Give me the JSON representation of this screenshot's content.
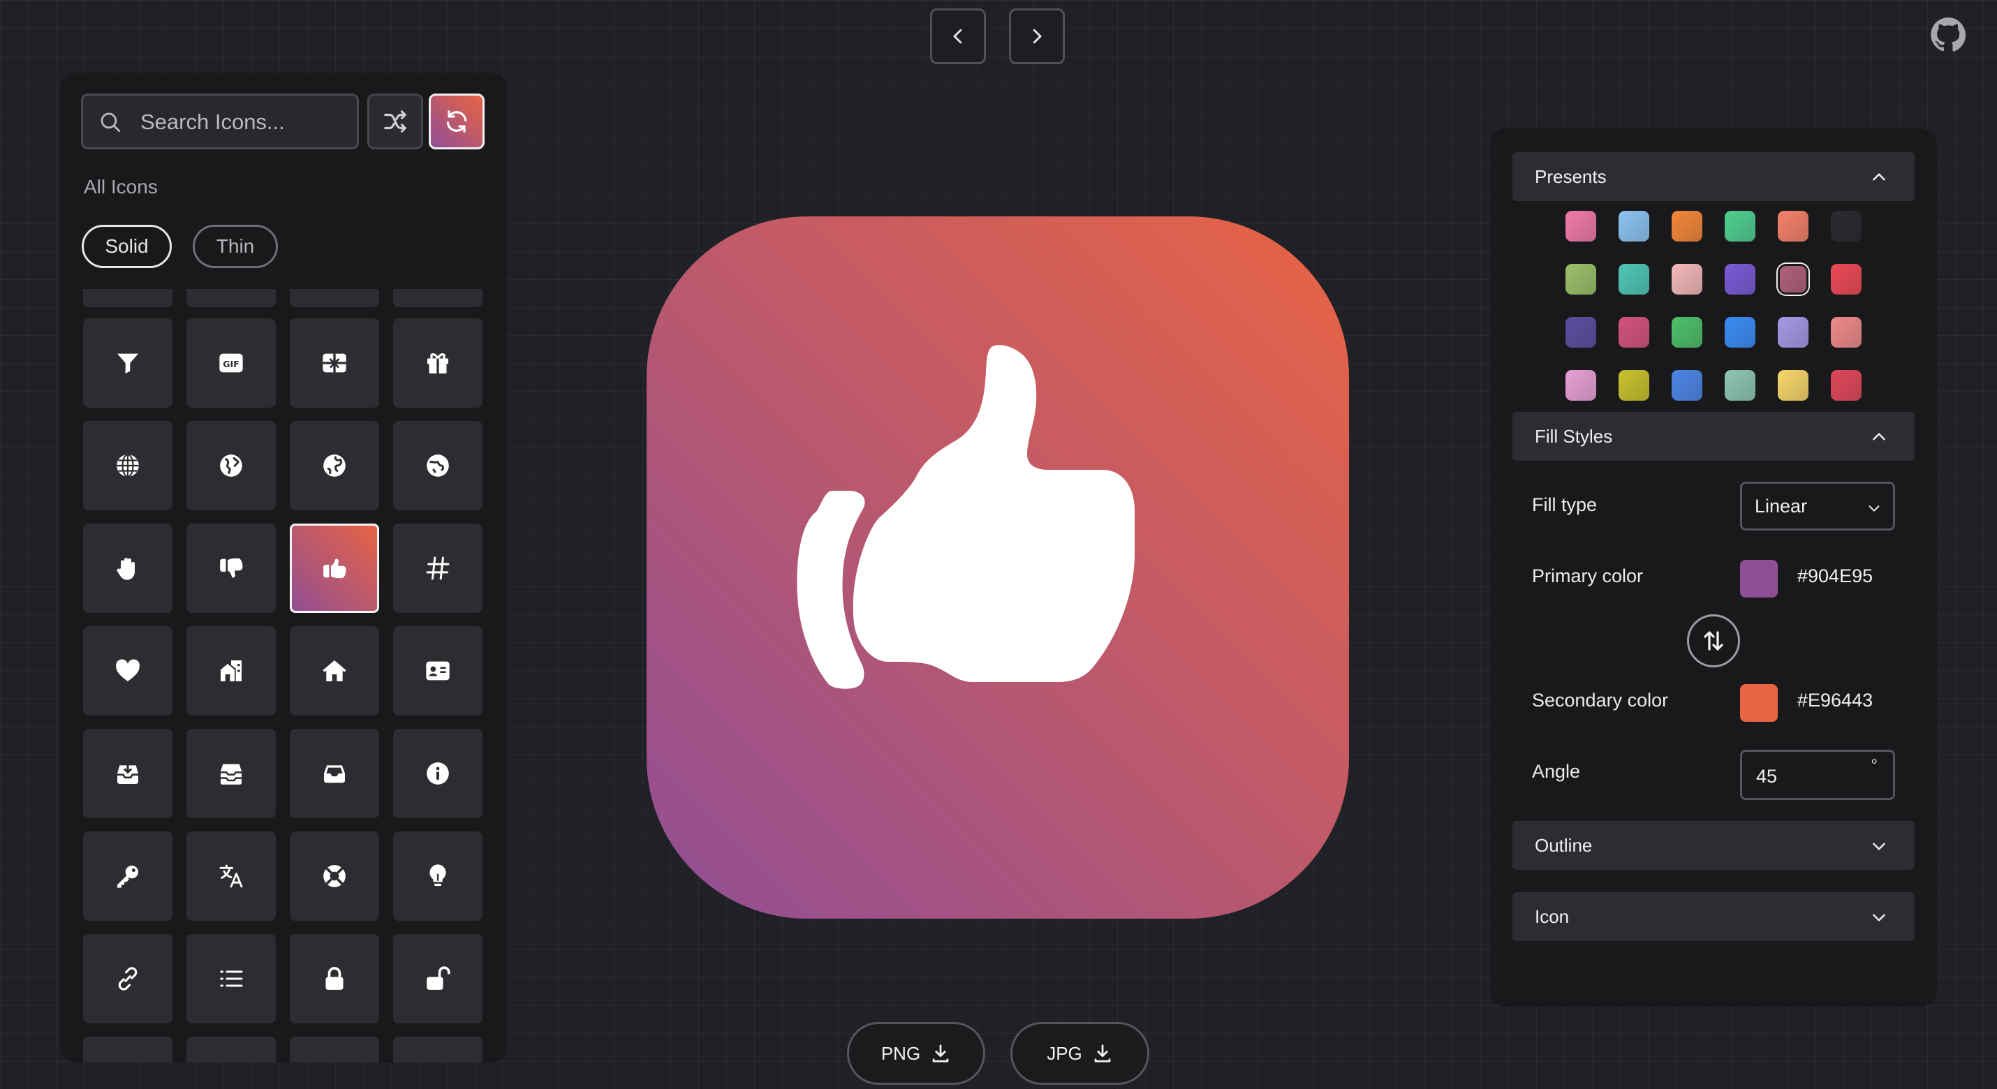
{
  "nav": {
    "prev_icon": "chevron-left-icon",
    "next_icon": "chevron-right-icon",
    "github_icon": "github-icon"
  },
  "sidebar": {
    "search_placeholder": "Search Icons...",
    "section_label": "All Icons",
    "styles": [
      "Solid",
      "Thin"
    ],
    "active_style": "Solid",
    "icons": [
      [
        "filter-icon",
        "gif-icon",
        "gift-card-icon",
        "gift-icon"
      ],
      [
        "globe-grid-icon",
        "globe-americas-icon",
        "globe-europe-icon",
        "globe-asia-icon"
      ],
      [
        "hand-icon",
        "thumbs-down-icon",
        "thumbs-up-icon",
        "hashtag-icon"
      ],
      [
        "heart-icon",
        "house-building-icon",
        "house-icon",
        "id-card-icon"
      ],
      [
        "inbox-download-icon",
        "inbox-stack-icon",
        "inbox-icon",
        "info-icon"
      ],
      [
        "key-icon",
        "translate-icon",
        "lifebuoy-icon",
        "lightbulb-icon"
      ],
      [
        "link-icon",
        "list-icon",
        "lock-icon",
        "unlock-icon"
      ]
    ],
    "selected_icon": "thumbs-up-icon"
  },
  "preview": {
    "icon": "thumbs-up-icon"
  },
  "downloads": {
    "png_label": "PNG",
    "jpg_label": "JPG"
  },
  "settings": {
    "presets_title": "Presents",
    "presets": [
      [
        "#f07aa8",
        "#8cc4f2",
        "#f3873a",
        "#4fcf8f",
        "#f4816a",
        "#2a2a2e"
      ],
      [
        "#9ac06a",
        "#4fc7b6",
        "#f4b8b8",
        "#7a5bd6",
        "#b0627a",
        "#ec4a56"
      ],
      [
        "#5a4fa0",
        "#d2527e",
        "#4fbf6a",
        "#3a8cf5",
        "#a49ae6",
        "#ee8a8a"
      ],
      [
        "#e8a0d6",
        "#c9c22e",
        "#4d86e6",
        "#8fc6b2",
        "#f7d66a",
        "#e0475a"
      ]
    ],
    "active_preset": "#b0627a",
    "fill_styles_title": "Fill Styles",
    "fill_type_label": "Fill type",
    "fill_type_value": "Linear",
    "primary_label": "Primary color",
    "primary_color": "#904E95",
    "secondary_label": "Secondary color",
    "secondary_color": "#E96443",
    "angle_label": "Angle",
    "angle_value": "45",
    "angle_unit": "°",
    "outline_title": "Outline",
    "icon_title": "Icon"
  }
}
